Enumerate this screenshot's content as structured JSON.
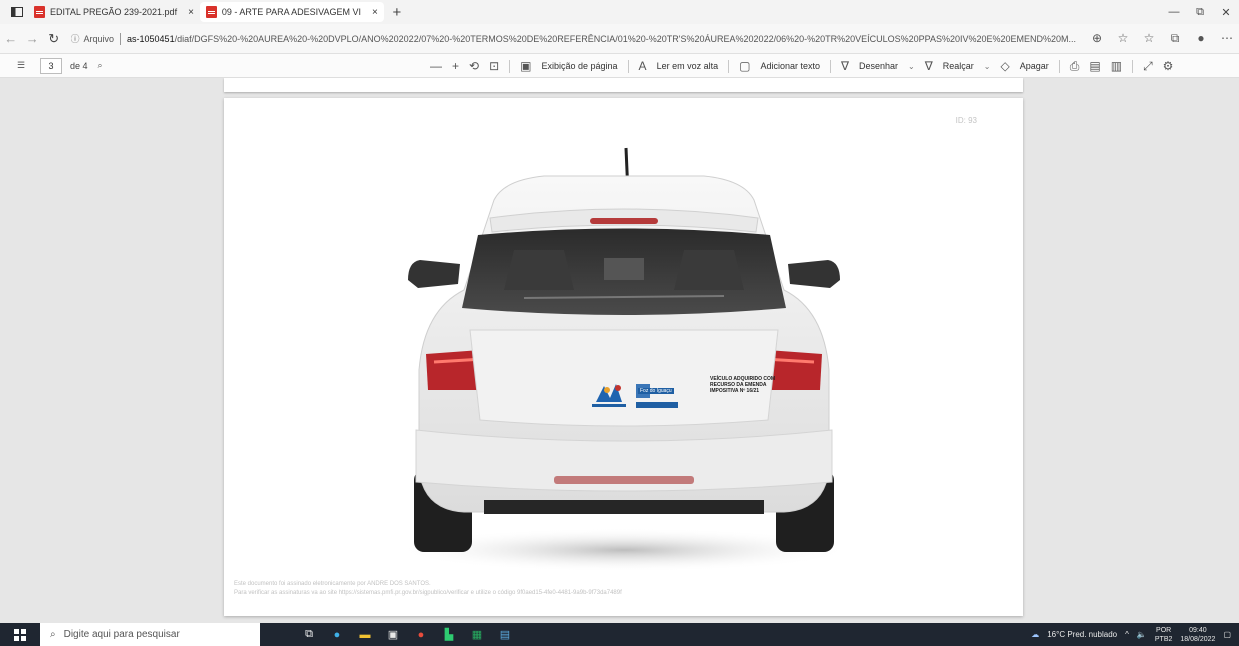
{
  "tabs": [
    {
      "title": "EDITAL PREGÃO 239-2021.pdf",
      "close": "×"
    },
    {
      "title": "09 - ARTE PARA ADESIVAGEM VI",
      "close": "×"
    }
  ],
  "new_tab": "+",
  "window_controls": {
    "minimize": "—",
    "restore": "⧉",
    "close": "✕"
  },
  "address": {
    "prefix": "Arquivo",
    "host": "as-1050451",
    "path": "/diaf/DGFS%20-%20AUREA%20-%20DVPLO/ANO%202022/07%20-%20TERMOS%20DE%20REFERÊNCIA/01%20-%20TR'S%20ÁUREA%202022/06%20-%20TR%20VEÍCULOS%20PPAS%20IV%20E%20EMEND%20M..."
  },
  "pdf_toolbar": {
    "page_current": "3",
    "page_total": "de 4",
    "view_label": "Exibição de página",
    "read_aloud_label": "Ler em voz alta",
    "add_text_label": "Adicionar texto",
    "draw_label": "Desenhar",
    "highlight_label": "Realçar",
    "erase_label": "Apagar"
  },
  "document": {
    "page_number": "ID: 93",
    "signature_line1": "Este documento foi assinado eletronicamente por ANDRE DOS SANTOS.",
    "signature_line2": "Para verificar as assinaturas va ao site https://sistemas.pmfi.pr.gov.br/sigpublico/verificar e utilize o código 9f0aed15-4fe0-4481-9a9b-9f73da7489f",
    "sticker_text_line1": "VEÍCULO ADQUIRIDO COM",
    "sticker_text_line2": "RECURSO DA EMENDA",
    "sticker_text_line3": "IMPOSITIVA Nº 16/21",
    "sticker_logo_text": "Foz do Iguaçu"
  },
  "taskbar": {
    "search_placeholder": "Digite aqui para pesquisar",
    "weather": "16°C  Pred. nublado",
    "lang_top": "POR",
    "lang_bottom": "PTB2",
    "time": "09:40",
    "date": "18/08/2022"
  },
  "colors": {
    "car_body": "#f1f1f1",
    "taillight": "#b8262b",
    "taskbar": "#1f2631",
    "pdf_icon": "#d9322b"
  }
}
